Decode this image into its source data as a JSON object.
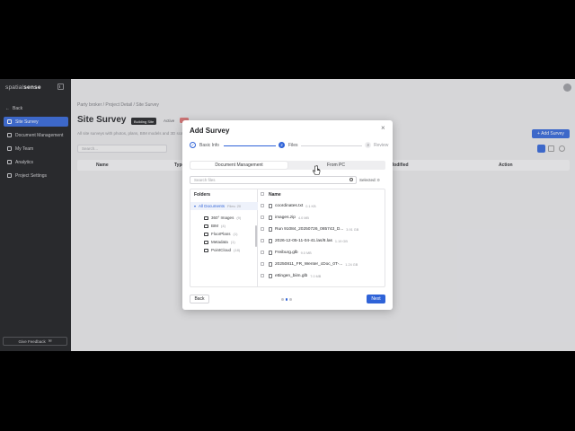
{
  "sidebar": {
    "logo_prefix": "spatial",
    "logo_suffix": "sense",
    "back_label": "Back",
    "items": [
      {
        "label": "Site Survey",
        "active": true
      },
      {
        "label": "Document Management",
        "active": false
      },
      {
        "label": "My Team",
        "active": false
      },
      {
        "label": "Analytics",
        "active": false
      },
      {
        "label": "Project Settings",
        "active": false
      }
    ],
    "feedback_label": "Give Feedback"
  },
  "page": {
    "breadcrumb": "Party broker / Project Detail / Site Survey",
    "title": "Site Survey",
    "tag_building": "Building Site",
    "tag_active": "Active",
    "subtitle": "All site surveys with photos, plans, BIM models and 3D scans",
    "add_survey_label": "+ Add Survey",
    "search_placeholder": "Search...",
    "table_headers": [
      "Name",
      "Type",
      "Modified",
      "Action"
    ]
  },
  "modal": {
    "title": "Add Survey",
    "close_glyph": "×",
    "steps": [
      {
        "number": "✓",
        "label": "Basic Info",
        "state": "done"
      },
      {
        "number": "2",
        "label": "Files",
        "state": "current"
      },
      {
        "number": "3",
        "label": "Review",
        "state": "todo"
      }
    ],
    "tabs": [
      {
        "label": "Document Management",
        "active": true
      },
      {
        "label": "From PC",
        "active": false
      }
    ],
    "search_placeholder": "Search files",
    "selected_label": "Selected: 0",
    "folders_header": "Folders",
    "files_header": "Name",
    "folders": [
      {
        "label": "All Documents",
        "count": "Files: 20",
        "selected": true,
        "indent": false
      },
      {
        "label": "360° Images",
        "count": "(9)",
        "selected": false,
        "indent": true
      },
      {
        "label": "BIM",
        "count": "(4)",
        "selected": false,
        "indent": true
      },
      {
        "label": "FloorPlans",
        "count": "(1)",
        "selected": false,
        "indent": true
      },
      {
        "label": "Metadata",
        "count": "(1)",
        "selected": false,
        "indent": true
      },
      {
        "label": "PointCloud",
        "count": "(18)",
        "selected": false,
        "indent": true
      }
    ],
    "files": [
      {
        "name": "coordinates.txt",
        "size": "0.1 KB"
      },
      {
        "name": "images.zip",
        "size": "4.0 MB"
      },
      {
        "name": "Run 91084_20250726_085743_D...",
        "size": "3.91 GB"
      },
      {
        "name": "2026-12-05-11-04-41.las/8.las",
        "size": "1.19 GB"
      },
      {
        "name": "Freiburg.glb",
        "size": "9.0 MB"
      },
      {
        "name": "20250811_FR_Wenter_cDoc_0T-...",
        "size": "1.24 GB"
      },
      {
        "name": "ettingen_biim.glb",
        "size": "7.0 MB"
      }
    ],
    "back_label": "Back",
    "next_label": "Next"
  },
  "colors": {
    "accent": "#2f63d8",
    "sidebar_bg": "#17181a"
  }
}
